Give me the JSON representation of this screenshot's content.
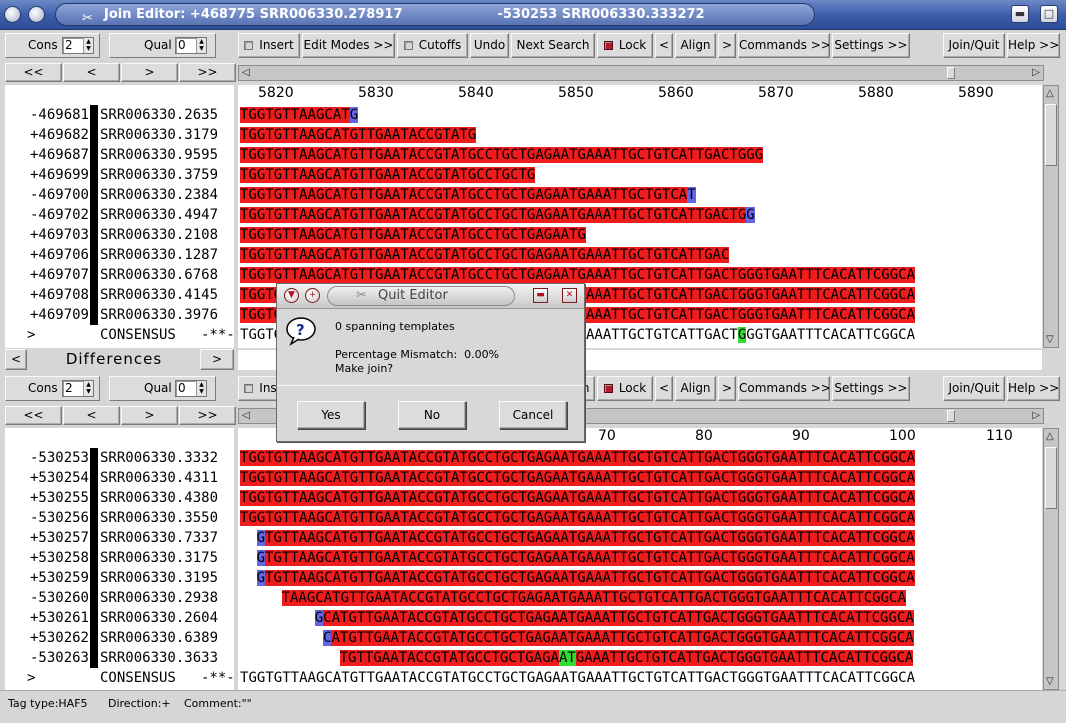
{
  "window": {
    "title": "Join Editor: +468775 SRR006330.278917                     -530253 SRR006330.333272"
  },
  "toolbar": {
    "cons_label": "Cons",
    "cons_value": "2",
    "qual_label": "Qual",
    "qual_value": "0",
    "insert": "Insert",
    "edit_modes": "Edit Modes >>",
    "cutoffs": "Cutoffs",
    "undo": "Undo",
    "next_search": "Next Search",
    "lock": "Lock",
    "left": "<",
    "align": "Align",
    "right": ">",
    "commands": "Commands >>",
    "settings": "Settings >>",
    "join_quit": "Join/Quit",
    "help": "Help >>",
    "nav": [
      "<<",
      "<",
      ">",
      ">>"
    ]
  },
  "top_panel": {
    "ruler": [
      "5820",
      "5830",
      "5840",
      "5850",
      "5860",
      "5870",
      "5880",
      "5890"
    ],
    "reads": [
      {
        "dir": "-469681",
        "name": "SRR006330.2635",
        "seq": "TGGTGTTAAGCATG"
      },
      {
        "dir": "+469682",
        "name": "SRR006330.3179",
        "seq": "TGGTGTTAAGCATGTTGAATACCGTATG"
      },
      {
        "dir": "+469687",
        "name": "SRR006330.9595",
        "seq": "TGGTGTTAAGCATGTTGAATACCGTATGCCTGCTGAGAATGAAATTGCTGTCATTGACTGGG"
      },
      {
        "dir": "+469699",
        "name": "SRR006330.3759",
        "seq": "TGGTGTTAAGCATGTTGAATACCGTATGCCTGCTG"
      },
      {
        "dir": "-469700",
        "name": "SRR006330.2384",
        "seq": "TGGTGTTAAGCATGTTGAATACCGTATGCCTGCTGAGAATGAAATTGCTGTCAT"
      },
      {
        "dir": "-469702",
        "name": "SRR006330.4947",
        "seq": "TGGTGTTAAGCATGTTGAATACCGTATGCCTGCTGAGAATGAAATTGCTGTCATTGACTGG"
      },
      {
        "dir": "+469703",
        "name": "SRR006330.2108",
        "seq": "TGGTGTTAAGCATGTTGAATACCGTATGCCTGCTGAGAATG"
      },
      {
        "dir": "+469706",
        "name": "SRR006330.1287",
        "seq": "TGGTGTTAAGCATGTTGAATACCGTATGCCTGCTGAGAATGAAATTGCTGTCATTGAC"
      },
      {
        "dir": "+469707",
        "name": "SRR006330.6768",
        "seq": "TGGTGTTAAGCATGTTGAATACCGTATGCCTGCTGAGAATGAAATTGCTGTCATTGACTGGGTGAATTTCACATTCGGCA"
      },
      {
        "dir": "+469708",
        "name": "SRR006330.4145",
        "seq": "TGGTGTTAAGCATGTTGAATACCGTATGCCTGCTGAGAATGAAATTGCTGTCATTGACTGGGTGAATTTCACATTCGGCA"
      },
      {
        "dir": "+469709",
        "name": "SRR006330.3976",
        "seq": "TGGTGTTAAGCATGTTGAATACCGTATGCCTGCTGAGAATGAAATTGCTGTCATTGACTGGGTGAATTTCACATTCGGCA"
      }
    ],
    "consensus": {
      "dir": ">",
      "name": "CONSENSUS",
      "tag": "-**-",
      "seq": "TGGTGTTAAGCATGTTGAATACCGTATGCCTGCTGAGAATGAAATTGCTGTCATTGACTGGGTGAATTTCACATTCGGCA"
    }
  },
  "differences": {
    "label": "Differences",
    "left": "<",
    "right": ">"
  },
  "bottom_panel": {
    "ruler": [
      "70",
      "80",
      "90",
      "100",
      "110"
    ],
    "reads": [
      {
        "dir": "-530253",
        "name": "SRR006330.3332",
        "offset": 0,
        "seq": "TGGTGTTAAGCATGTTGAATACCGTATGCCTGCTGAGAATGAAATTGCTGTCATTGACTGGGTGAATTTCACATTCGGCA"
      },
      {
        "dir": "+530254",
        "name": "SRR006330.4311",
        "offset": 0,
        "seq": "TGGTGTTAAGCATGTTGAATACCGTATGCCTGCTGAGAATGAAATTGCTGTCATTGACTGGGTGAATTTCACATTCGGCA"
      },
      {
        "dir": "+530255",
        "name": "SRR006330.4380",
        "offset": 0,
        "seq": "TGGTGTTAAGCATGTTGAATACCGTATGCCTGCTGAGAATGAAATTGCTGTCATTGACTGGGTGAATTTCACATTCGGCA"
      },
      {
        "dir": "-530256",
        "name": "SRR006330.3550",
        "offset": 0,
        "seq": "TGGTGTTAAGCATGTTGAATACCGTATGCCTGCTGAGAATGAAATTGCTGTCATTGACTGGGTGAATTTCACATTCGGCA"
      },
      {
        "dir": "+530257",
        "name": "SRR006330.7337",
        "offset": 2,
        "seq": "GTGTTAAGCATGTTGAATACCGTATGCCTGCTGAGAATGAAATTGCTGTCATTGACTGGGTGAATTTCACATTCGGCA"
      },
      {
        "dir": "+530258",
        "name": "SRR006330.3175",
        "offset": 2,
        "seq": "GTGTTAAGCATGTTGAATACCGTATGCCTGCTGAGAATGAAATTGCTGTCATTGACTGGGTGAATTTCACATTCGGCA"
      },
      {
        "dir": "+530259",
        "name": "SRR006330.3195",
        "offset": 2,
        "seq": "GTGTTAAGCATGTTGAATACCGTATGCCTGCTGAGAATGAAATTGCTGTCATTGACTGGGTGAATTTCACATTCGGCA"
      },
      {
        "dir": "-530260",
        "name": "SRR006330.2938",
        "offset": 5,
        "seq": "TAAGCATGTTGAATACCGTATGCCTGCTGAGAATGAAATTGCTGTCATTGACTGGGTGAATTTCACATTCGGCA"
      },
      {
        "dir": "+530261",
        "name": "SRR006330.2604",
        "offset": 9,
        "seq": "GCATGTTGAATACCGTATGCCTGCTGAGAATGAAATTGCTGTCATTGACTGGGTGAATTTCACATTCGGCA"
      },
      {
        "dir": "+530262",
        "name": "SRR006330.6389",
        "offset": 10,
        "seq": "CATGTTGAATACCGTATGCCTGCTGAGAATGAAATTGCTGTCATTGACTGGGTGAATTTCACATTCGGCA"
      },
      {
        "dir": "-530263",
        "name": "SRR006330.3633",
        "offset": 12,
        "seq": "TGTTGAATACCGTATGCCTGCTGAGAATGAAATTGCTGTCATTGACTGGGTGAATTTCACATTCGGCA"
      }
    ],
    "consensus": {
      "dir": ">",
      "name": "CONSENSUS",
      "tag": "-**-",
      "seq": "TGGTGTTAAGCATGTTGAATACCGTATGCCTGCTGAGAATGAAATTGCTGTCATTGACTGGGTGAATTTCACATTCGGCA"
    }
  },
  "dialog": {
    "title": "Quit Editor",
    "line1": "0 spanning templates",
    "line2": "Percentage Mismatch:  0.00%",
    "line3": "Make join?",
    "yes": "Yes",
    "no": "No",
    "cancel": "Cancel"
  },
  "status": {
    "tag_type": "Tag type:HAF5",
    "direction": "Direction:+",
    "comment": "Comment:\"\""
  },
  "colors": {
    "read_bg": "#ee1c1c",
    "mismatch_bg": "#6464e6",
    "highlight_bg": "#32dc32"
  }
}
